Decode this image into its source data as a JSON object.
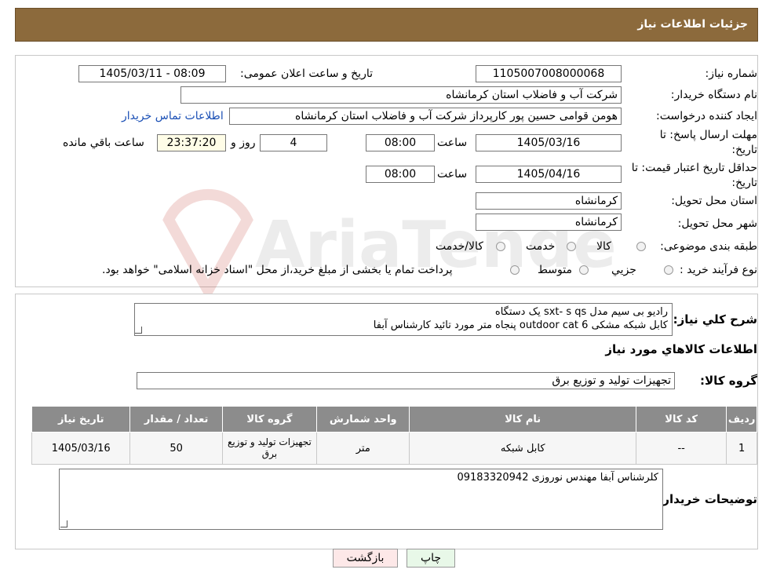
{
  "header": {
    "title": "جزئیات اطلاعات نیاز"
  },
  "info": {
    "need_number_label": "شماره نیاز:",
    "need_number": "1105007008000068",
    "announce_label": "تاریخ و ساعت اعلان عمومی:",
    "announce_value": "1405/03/11 - 08:09",
    "buyer_org_label": "نام دستگاه خریدار:",
    "buyer_org": "شرکت آب و فاضلاب استان کرمانشاه",
    "creator_label": "ایجاد کننده درخواست:",
    "creator": "هومن قوامی حسین پور کارپرداز شرکت آب و فاضلاب استان کرمانشاه",
    "contact_link": "اطلاعات تماس خریدار",
    "send_deadline_label_1": "مهلت ارسال پاسخ: تا",
    "send_deadline_label_2": "تاریخ:",
    "send_deadline_date": "1405/03/16",
    "time_label": "ساعت",
    "send_deadline_time": "08:00",
    "days_value": "4",
    "days_label": "روز و",
    "remaining_time": "23:37:20",
    "remaining_label": "ساعت باقي مانده",
    "validity_label_1": "حداقل تاریخ اعتبار قیمت: تا",
    "validity_label_2": "تاریخ:",
    "validity_date": "1405/04/16",
    "validity_time": "08:00",
    "province_label": "استان محل تحویل:",
    "province": "کرمانشاه",
    "city_label": "شهر محل تحویل:",
    "city": "کرمانشاه",
    "category_label": "طبقه بندی موضوعی:",
    "category_options": [
      "کالا",
      "خدمت",
      "کالا/خدمت"
    ],
    "process_label": "نوع فرآیند خرید :",
    "process_options": [
      "جزیي",
      "متوسط"
    ],
    "process_note": "پرداخت تمام یا بخشی از مبلغ خرید،از محل \"اسناد خزانه اسلامی\" خواهد بود."
  },
  "description": {
    "label": "شرح کلي نیاز:",
    "line1": "رادیو بی سیم مدل  sxt- s qs   یک دستگاه",
    "line2": "کابل شبکه مشکی outdoor cat 6      پنجاه متر مورد تائید کارشناس آبفا"
  },
  "goods": {
    "section_title": "اطلاعات کالاهاي مورد نیاز",
    "group_label": "گروه کالا:",
    "group_value": "تجهیزات تولید و توزیع برق",
    "columns": [
      "ردیف",
      "کد کالا",
      "نام کالا",
      "واحد شمارش",
      "گروه کالا",
      "تعداد / مقدار",
      "تاریخ نیاز"
    ],
    "rows": [
      [
        "1",
        "--",
        "کابل شبکه",
        "متر",
        "تجهیزات تولید و توزیع برق",
        "50",
        "1405/03/16"
      ]
    ]
  },
  "buyer_notes": {
    "label": "توضیحات خریدار:",
    "text": "کلرشناس آبفا مهندس نوروزی 09183320942"
  },
  "buttons": {
    "print": "چاپ",
    "back": "بازگشت"
  },
  "watermark": {
    "text": "AriaTender.neT"
  },
  "colors": {
    "header": "#8c6a3c",
    "table_header": "#8c8c8c",
    "link": "#1a4fb5",
    "back_button": "#fde8e8",
    "print_button": "#e8f8e8"
  }
}
